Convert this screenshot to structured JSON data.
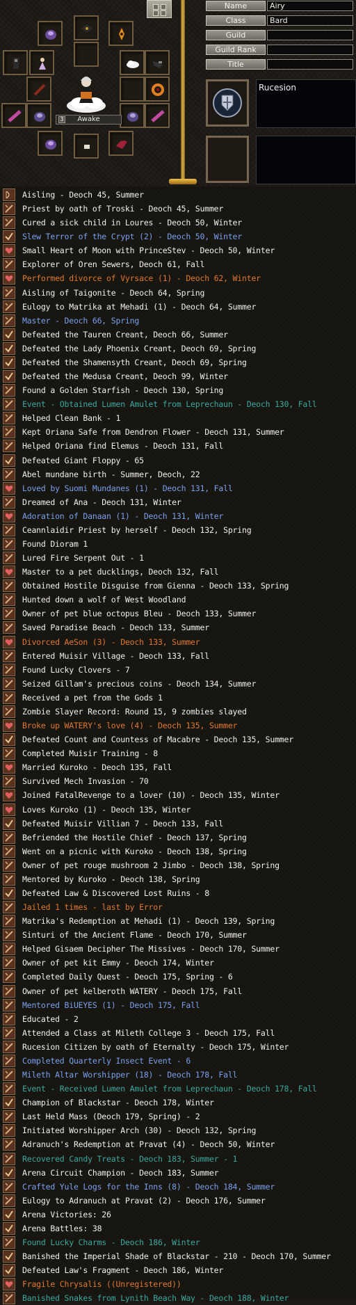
{
  "profile": {
    "awake_label": "Awake",
    "awake_level": "3",
    "fields": [
      {
        "label": "Name",
        "value": "Airy"
      },
      {
        "label": "Class",
        "value": "Bard"
      },
      {
        "label": "Guild",
        "value": ""
      },
      {
        "label": "Guild Rank",
        "value": ""
      },
      {
        "label": "Title",
        "value": ""
      }
    ],
    "nation_text": "Rucesion",
    "equipment_icons": [
      "purple-armor-icon",
      "dark-wings-icon",
      "orange-amulet-icon",
      "empty-slot",
      "dark-boots-icon",
      "lady-figure-icon",
      "cloud-icon",
      "dark-gauntlet-icon",
      "red-scroll-icon",
      "empty-slot",
      "orange-ring-icon",
      "pink-shell-icon",
      "purple-helm-icon",
      "purple-helm-icon",
      "pink-shell-icon",
      "purple-armor-icon",
      "small-item-icon",
      "red-fan-icon"
    ]
  },
  "colors": {
    "white": "#f2f0ea",
    "orange": "#e0782c",
    "blue": "#7aa0f0",
    "teal": "#3aa8a0"
  },
  "legends": [
    {
      "text": "Aisling - Deoch 45, Summer",
      "color": "white",
      "icon": "bow-icon"
    },
    {
      "text": "Priest by oath of Troski - Deoch 45, Summer",
      "color": "white",
      "icon": "scroll-icon"
    },
    {
      "text": "Cured a sick child in Loures - Deoch 50, Winter",
      "color": "white",
      "icon": "scroll-icon"
    },
    {
      "text": "Slew Terror of the Crypt (2) - Deoch 50, Winter",
      "color": "blue",
      "icon": "check-icon"
    },
    {
      "text": "Small Heart of Moon with PrinceStev - Deoch 50, Winter",
      "color": "white",
      "icon": "heart-icon"
    },
    {
      "text": "Explorer of Oren Sewers, Deoch 61, Fall",
      "color": "white",
      "icon": "scroll-icon"
    },
    {
      "text": "Performed divorce of Vyrsace (1) - Deoch 62, Winter",
      "color": "orange",
      "icon": "heart-icon"
    },
    {
      "text": "Aisling of Taigonite - Deoch 64, Spring",
      "color": "white",
      "icon": "scroll-icon"
    },
    {
      "text": "Eulogy to Matrika at Mehadi (1) - Deoch 64, Summer",
      "color": "white",
      "icon": "scroll-icon"
    },
    {
      "text": "Master - Deoch 66, Spring",
      "color": "blue",
      "icon": "scroll-icon"
    },
    {
      "text": "Defeated the Tauren Creant, Deoch 66, Summer",
      "color": "white",
      "icon": "check-icon"
    },
    {
      "text": "Defeated the Lady Phoenix Creant, Deoch 69, Spring",
      "color": "white",
      "icon": "check-icon"
    },
    {
      "text": "Defeated the Shamensyth Creant, Deoch 69, Spring",
      "color": "white",
      "icon": "check-icon"
    },
    {
      "text": "Defeated the Medusa Creant, Deoch 99, Winter",
      "color": "white",
      "icon": "check-icon"
    },
    {
      "text": "Found a Golden Starfish - Deoch 130, Spring",
      "color": "white",
      "icon": "scroll-icon"
    },
    {
      "text": "Event - Obtained Lumen Amulet from Leprechaun - Deoch 130, Fall",
      "color": "teal",
      "icon": "scroll-icon"
    },
    {
      "text": "Helped Clean Bank - 1",
      "color": "white",
      "icon": "scroll-icon"
    },
    {
      "text": "Kept Oriana Safe from Dendron Flower - Deoch 131, Summer",
      "color": "white",
      "icon": "scroll-icon"
    },
    {
      "text": "Helped Oriana find Elemus - Deoch 131, Fall",
      "color": "white",
      "icon": "scroll-icon"
    },
    {
      "text": "Defeated Giant Floppy - 65",
      "color": "white",
      "icon": "check-icon"
    },
    {
      "text": "Abel mundane birth - Summer, Deoch, 22",
      "color": "white",
      "icon": "scroll-icon"
    },
    {
      "text": "Loved by Suomi Mundanes (1) - Deoch 131, Fall",
      "color": "blue",
      "icon": "heart-icon"
    },
    {
      "text": "Dreamed of Ana - Deoch 131, Winter",
      "color": "white",
      "icon": "scroll-icon"
    },
    {
      "text": "Adoration of Danaan (1) - Deoch 131, Winter",
      "color": "blue",
      "icon": "heart-icon"
    },
    {
      "text": "Ceannlaidir Priest by herself - Deoch 132, Spring",
      "color": "white",
      "icon": "scroll-icon"
    },
    {
      "text": "Found Dioram 1",
      "color": "white",
      "icon": "scroll-icon"
    },
    {
      "text": "Lured Fire Serpent Out - 1",
      "color": "white",
      "icon": "scroll-icon"
    },
    {
      "text": "Master to a pet ducklings, Deoch 132, Fall",
      "color": "white",
      "icon": "heart-icon"
    },
    {
      "text": "Obtained Hostile Disguise from Gienna - Deoch 133, Spring",
      "color": "white",
      "icon": "scroll-icon"
    },
    {
      "text": "Hunted down a wolf of West Woodland",
      "color": "white",
      "icon": "scroll-icon"
    },
    {
      "text": "Owner of pet blue octopus Bleu - Deoch 133, Summer",
      "color": "white",
      "icon": "scroll-icon"
    },
    {
      "text": "Saved Paradise Beach - Deoch 133, Summer",
      "color": "white",
      "icon": "scroll-icon"
    },
    {
      "text": "Divorced AeSon (3) - Deoch 133, Summer",
      "color": "orange",
      "icon": "heart-icon"
    },
    {
      "text": "Entered Muisir Village - Deoch 133, Fall",
      "color": "white",
      "icon": "scroll-icon"
    },
    {
      "text": "Found Lucky Clovers - 7",
      "color": "white",
      "icon": "scroll-icon"
    },
    {
      "text": "Seized Gillam's precious coins - Deoch 134, Summer",
      "color": "white",
      "icon": "scroll-icon"
    },
    {
      "text": "Received a pet from the Gods 1",
      "color": "white",
      "icon": "scroll-icon"
    },
    {
      "text": "Zombie Slayer Record: Round 15, 9 zombies slayed",
      "color": "white",
      "icon": "scroll-icon"
    },
    {
      "text": "Broke up WATERY's love (4) - Deoch 135, Summer",
      "color": "orange",
      "icon": "heart-icon"
    },
    {
      "text": "Defeated Count and Countess of Macabre - Deoch 135, Summer",
      "color": "white",
      "icon": "check-icon"
    },
    {
      "text": "Completed Muisir Training - 8",
      "color": "white",
      "icon": "scroll-icon"
    },
    {
      "text": "Married Kuroko - Deoch 135, Fall",
      "color": "white",
      "icon": "heart-icon"
    },
    {
      "text": "Survived Mech Invasion - 70",
      "color": "white",
      "icon": "scroll-icon"
    },
    {
      "text": "Joined FatalRevenge to a lover (10) - Deoch 135, Winter",
      "color": "white",
      "icon": "heart-icon"
    },
    {
      "text": "Loves Kuroko (1) - Deoch 135, Winter",
      "color": "white",
      "icon": "heart-icon"
    },
    {
      "text": "Defeated Muisir Villian 7 - Deoch 133, Fall",
      "color": "white",
      "icon": "check-icon"
    },
    {
      "text": "Befriended the Hostile Chief - Deoch 137, Spring",
      "color": "white",
      "icon": "scroll-icon"
    },
    {
      "text": "Went on a picnic with Kuroko - Deoch 138, Spring",
      "color": "white",
      "icon": "scroll-icon"
    },
    {
      "text": "Owner of pet rouge mushroom 2 Jimbo - Deoch 138, Spring",
      "color": "white",
      "icon": "scroll-icon"
    },
    {
      "text": "Mentored by Kuroko - Deoch 138, Spring",
      "color": "white",
      "icon": "scroll-icon"
    },
    {
      "text": "Defeated Law & Discovered Lost Ruins - 8",
      "color": "white",
      "icon": "check-icon"
    },
    {
      "text": "Jailed 1 times - last by Error",
      "color": "orange",
      "icon": "scroll-icon"
    },
    {
      "text": "Matrika's Redemption at Mehadi (1) - Deoch 139, Spring",
      "color": "white",
      "icon": "scroll-icon"
    },
    {
      "text": "Sinturi of the Ancient Flame - Deoch 170, Summer",
      "color": "white",
      "icon": "scroll-icon"
    },
    {
      "text": "Helped Gisaem Decipher The Missives - Deoch 170, Summer",
      "color": "white",
      "icon": "scroll-icon"
    },
    {
      "text": "Owner of pet kit Emmy - Deoch 174, Winter",
      "color": "white",
      "icon": "scroll-icon"
    },
    {
      "text": "Completed Daily Quest - Deoch 175, Spring - 6",
      "color": "white",
      "icon": "scroll-icon"
    },
    {
      "text": "Owner of pet kelberoth WATERY - Deoch 175, Fall",
      "color": "white",
      "icon": "scroll-icon"
    },
    {
      "text": "Mentored BiUEYES (1) - Deoch 175, Fall",
      "color": "blue",
      "icon": "scroll-icon"
    },
    {
      "text": "Educated - 2",
      "color": "white",
      "icon": "scroll-icon"
    },
    {
      "text": "Attended a Class at Mileth College 3 - Deoch 175, Fall",
      "color": "white",
      "icon": "scroll-icon"
    },
    {
      "text": "Rucesion Citizen by oath of Eternalty - Deoch 175, Winter",
      "color": "white",
      "icon": "scroll-icon"
    },
    {
      "text": "Completed Quarterly Insect Event - 6",
      "color": "blue",
      "icon": "scroll-icon"
    },
    {
      "text": "Mileth Altar Worshipper (18) - Deoch 178, Fall",
      "color": "blue",
      "icon": "scroll-icon"
    },
    {
      "text": "Event - Received Lumen Amulet from Leprechaun - Deoch 178, Fall",
      "color": "teal",
      "icon": "scroll-icon"
    },
    {
      "text": "Champion of Blackstar - Deoch 178, Winter",
      "color": "white",
      "icon": "check-icon"
    },
    {
      "text": "Last Held Mass (Deoch 179, Spring) - 2",
      "color": "white",
      "icon": "scroll-icon"
    },
    {
      "text": "Initiated Worshipper Arch (30) - Deoch 132, Spring",
      "color": "white",
      "icon": "scroll-icon"
    },
    {
      "text": "Adranuch's Redemption at Pravat (4) - Deoch 50, Winter",
      "color": "white",
      "icon": "scroll-icon"
    },
    {
      "text": "Recovered Candy Treats - Deoch 183, Summer - 1",
      "color": "teal",
      "icon": "scroll-icon"
    },
    {
      "text": "Arena Circuit Champion - Deoch 183, Summer",
      "color": "white",
      "icon": "check-icon"
    },
    {
      "text": "Crafted Yule Logs for the Inns (8) - Deoch 184, Summer",
      "color": "blue",
      "icon": "scroll-icon"
    },
    {
      "text": "Eulogy to Adranuch at Pravat (2) - Deoch 176, Summer",
      "color": "white",
      "icon": "scroll-icon"
    },
    {
      "text": "Arena Victories: 26",
      "color": "white",
      "icon": "check-icon"
    },
    {
      "text": "Arena Battles: 38",
      "color": "white",
      "icon": "check-icon"
    },
    {
      "text": "Found Lucky Charms - Deoch 186, Winter",
      "color": "teal",
      "icon": "scroll-icon"
    },
    {
      "text": "Banished the Imperial Shade of Blackstar - 210 - Deoch 170, Summer",
      "color": "white",
      "icon": "check-icon"
    },
    {
      "text": "Defeated Law's Fragment - Deoch 186, Winter",
      "color": "white",
      "icon": "check-icon"
    },
    {
      "text": "Fragile Chrysalis ((Unregistered))",
      "color": "orange",
      "icon": "heart-icon"
    },
    {
      "text": "Banished Snakes from Lynith Beach Way - Deoch 188, Winter",
      "color": "teal",
      "icon": "scroll-icon"
    }
  ]
}
